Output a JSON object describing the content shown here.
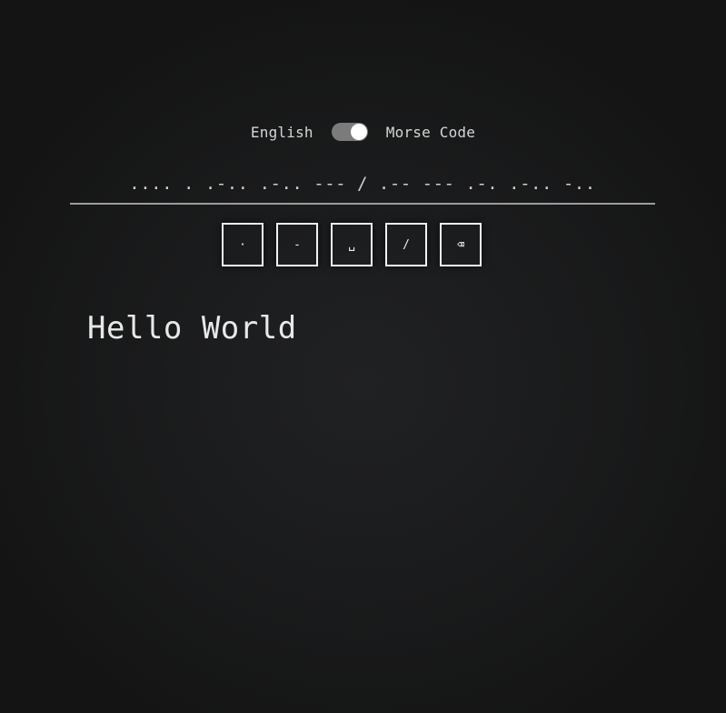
{
  "toggle": {
    "left_label": "English",
    "right_label": "Morse Code",
    "state": "morse"
  },
  "input": {
    "value": ".... . .-.. .-.. --- / .-- --- .-. .-.. -.."
  },
  "keypad": {
    "keys": [
      {
        "label": "·"
      },
      {
        "label": "-"
      },
      {
        "label": "␣"
      },
      {
        "label": "/"
      },
      {
        "label": "⌫"
      }
    ]
  },
  "output": {
    "text": "Hello World"
  }
}
